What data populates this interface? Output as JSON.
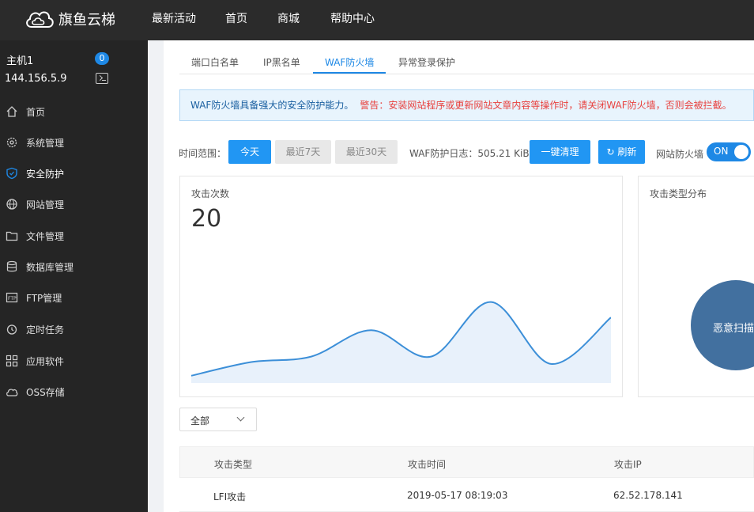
{
  "brand": {
    "name": "旗鱼云梯",
    "logo_icon": "cloud-logo-icon"
  },
  "topnav": [
    "最新活动",
    "首页",
    "商城",
    "帮助中心"
  ],
  "host": {
    "name": "主机1",
    "badge": "0",
    "ip": "144.156.5.9"
  },
  "sidebar": {
    "items": [
      {
        "label": "首页",
        "icon": "home-icon"
      },
      {
        "label": "系统管理",
        "icon": "gear-icon"
      },
      {
        "label": "安全防护",
        "icon": "shield-icon",
        "active": true
      },
      {
        "label": "网站管理",
        "icon": "globe-icon"
      },
      {
        "label": "文件管理",
        "icon": "folder-icon"
      },
      {
        "label": "数据库管理",
        "icon": "database-icon"
      },
      {
        "label": "FTP管理",
        "icon": "ftp-icon"
      },
      {
        "label": "定时任务",
        "icon": "clock-icon"
      },
      {
        "label": "应用软件",
        "icon": "apps-icon"
      },
      {
        "label": "OSS存储",
        "icon": "cloud-storage-icon"
      }
    ]
  },
  "tabs": [
    {
      "label": "端口白名单"
    },
    {
      "label": "IP黑名单"
    },
    {
      "label": "WAF防火墙",
      "active": true
    },
    {
      "label": "异常登录保护"
    }
  ],
  "notice": {
    "main": "WAF防火墙具备强大的安全防护能力。",
    "warning": "警告：安装网站程序或更新网站文章内容等操作时，请关闭WAF防火墙，否则会被拦截。"
  },
  "filter": {
    "label": "时间范围：",
    "today": "今天",
    "last7": "最近7天",
    "last30": "最近30天",
    "log_text": "WAF防护日志：505.21 KiB",
    "clear": "一键清理",
    "refresh": "刷新",
    "firewall_label": "网站防火墙",
    "toggle": "ON"
  },
  "attack_card": {
    "title": "攻击次数",
    "count": "20"
  },
  "type_card": {
    "title": "攻击类型分布",
    "slice_label": "恶意扫描"
  },
  "chart_data": {
    "type": "area",
    "values": [
      0.08,
      0.23,
      0.29,
      0.58,
      0.29,
      0.89,
      0.21,
      0.72
    ],
    "ylim": [
      0,
      1
    ],
    "grid": false,
    "legend": "none"
  },
  "colors": {
    "accent": "#2196f3",
    "sidebar": "#252525",
    "topbar": "#2b2b2b",
    "pie": "#42709f",
    "warning": "#e8423f"
  },
  "table_filter": {
    "selected": "全部"
  },
  "table": {
    "columns": [
      "攻击类型",
      "攻击时间",
      "攻击IP"
    ],
    "rows": [
      [
        "LFI攻击",
        "2019-05-17 08:19:03",
        "62.52.178.141"
      ]
    ]
  }
}
